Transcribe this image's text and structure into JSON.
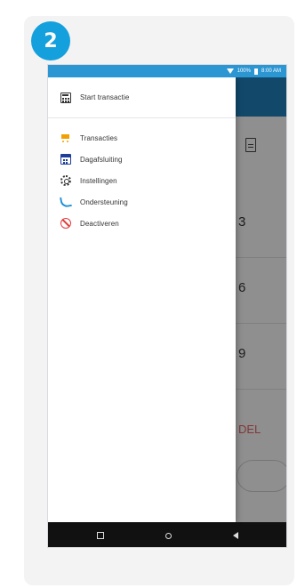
{
  "step": {
    "number": "2"
  },
  "status_bar": {
    "battery": "100%",
    "time": "8:00 AM"
  },
  "background_screen": {
    "numbers": [
      "3",
      "6",
      "9"
    ],
    "cancel_label": "DEL"
  },
  "drawer": {
    "top_item": {
      "label": "Start transactie",
      "icon": "cash-register-icon"
    },
    "items": [
      {
        "label": "Transacties",
        "icon": "cart-icon",
        "color": "#f0a000"
      },
      {
        "label": "Dagafsluiting",
        "icon": "calendar-icon",
        "color": "#1d3f9a"
      },
      {
        "label": "Instellingen",
        "icon": "gear-icon",
        "color": "#333333"
      },
      {
        "label": "Ondersteuning",
        "icon": "phone-icon",
        "color": "#1a8fd8"
      },
      {
        "label": "Deactiveren",
        "icon": "block-icon",
        "color": "#e23a3a"
      }
    ]
  },
  "nav_bar": {
    "buttons": [
      "recent-apps",
      "home",
      "back"
    ]
  },
  "colors": {
    "accent": "#14a0dc",
    "status_bar": "#2c96d3",
    "app_header": "#1f7fb8"
  }
}
